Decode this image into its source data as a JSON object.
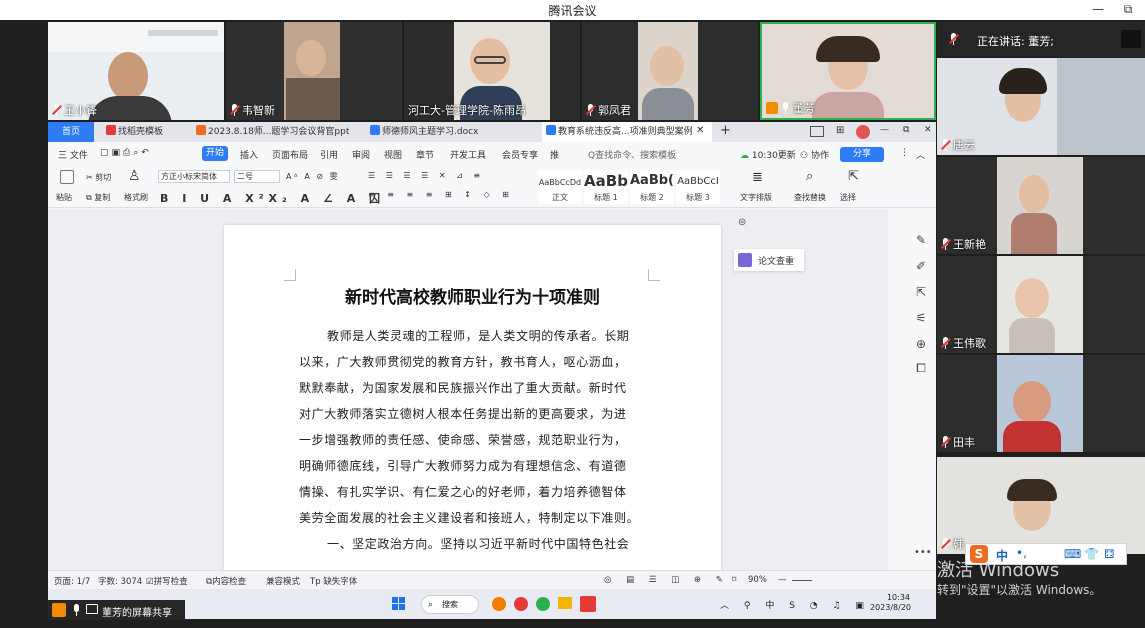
{
  "app": {
    "title": "腾讯会议"
  },
  "window_buttons": {
    "minimize": "—",
    "restore": "⧉"
  },
  "top_participants": [
    {
      "name": "王小锋",
      "muted": true
    },
    {
      "name": "韦智新",
      "muted": true
    },
    {
      "name": "河工大-管理学院-陈雨昂",
      "muted": false
    },
    {
      "name": "郭凤君",
      "muted": true
    },
    {
      "name": "董芳",
      "muted": false,
      "host": true
    }
  ],
  "speaking": {
    "label": "正在讲话:",
    "name": "董芳;"
  },
  "side_participants": [
    {
      "name": "唐云"
    },
    {
      "name": "王新艳"
    },
    {
      "name": "王伟歌"
    },
    {
      "name": "田丰"
    },
    {
      "name": "韩"
    }
  ],
  "wps": {
    "tabs": [
      {
        "label": "首页"
      },
      {
        "label": "找稻壳模板"
      },
      {
        "label": "2023.8.18师...题学习会议背官ppt"
      },
      {
        "label": "师德师风主题学习.docx"
      },
      {
        "label": "教育系统违反高...项准则典型案例"
      }
    ],
    "tab_close": "✕",
    "tab_add": "+",
    "menu": {
      "file": "三 文件",
      "start": "开始",
      "items": [
        "插入",
        "页面布局",
        "引用",
        "审阅",
        "视图",
        "章节",
        "开发工具",
        "会员专享",
        "推"
      ],
      "search": "Q查找命令、搜索模板",
      "updated": "10:30更新",
      "collab": "协作",
      "share": "分享"
    },
    "ribbon": {
      "paste": "粘贴",
      "cut": "剪切",
      "copy": "复制",
      "format_painter": "格式刷",
      "font": "方正小标宋简体",
      "size": "二号",
      "styles": [
        {
          "preview": "AaBbCcDd",
          "label": "正文"
        },
        {
          "preview": "AaBb",
          "label": "标题 1"
        },
        {
          "preview": "AaBb(",
          "label": "标题 2"
        },
        {
          "preview": "AaBbCcI",
          "label": "标题 3"
        }
      ],
      "text_layout": "文字排版",
      "find_replace": "查找替换",
      "select": "选择"
    },
    "doc": {
      "title": "新时代高校教师职业行为十项准则",
      "lines": [
        "教师是人类灵魂的工程师，是人类文明的传承者。长期",
        "以来，广大教师贯彻党的教育方针，教书育人，呕心沥血，",
        "默默奉献，为国家发展和民族振兴作出了重大贡献。新时代",
        "对广大教师落实立德树人根本任务提出新的更高要求，为进",
        "一步增强教师的责任感、使命感、荣誉感，规范职业行为，",
        "明确师德底线，引导广大教师努力成为有理想信念、有道德",
        "情操、有扎实学识、有仁爱之心的好老师，着力培养德智体",
        "美劳全面发展的社会主义建设者和接班人，特制定以下准则。",
        "一、坚定政治方向。坚持以习近平新时代中国特色社会"
      ]
    },
    "thesis_check": "论文查重",
    "status": {
      "page": "页面: 1/7",
      "words": "字数: 3074",
      "spell": "拼写检查",
      "content": "内容检查",
      "compat": "兼容模式",
      "missing_font": "缺失字体",
      "zoom": "90%"
    },
    "taskbar": {
      "search": "搜索",
      "time": "10:34",
      "date": "2023/8/20",
      "ime_char": "中"
    }
  },
  "screen_share": {
    "label": "董芳的屏幕共享"
  },
  "ime": {
    "lang": "中"
  },
  "activate_windows": {
    "title": "激活 Windows",
    "sub": "转到\"设置\"以激活 Windows。"
  }
}
